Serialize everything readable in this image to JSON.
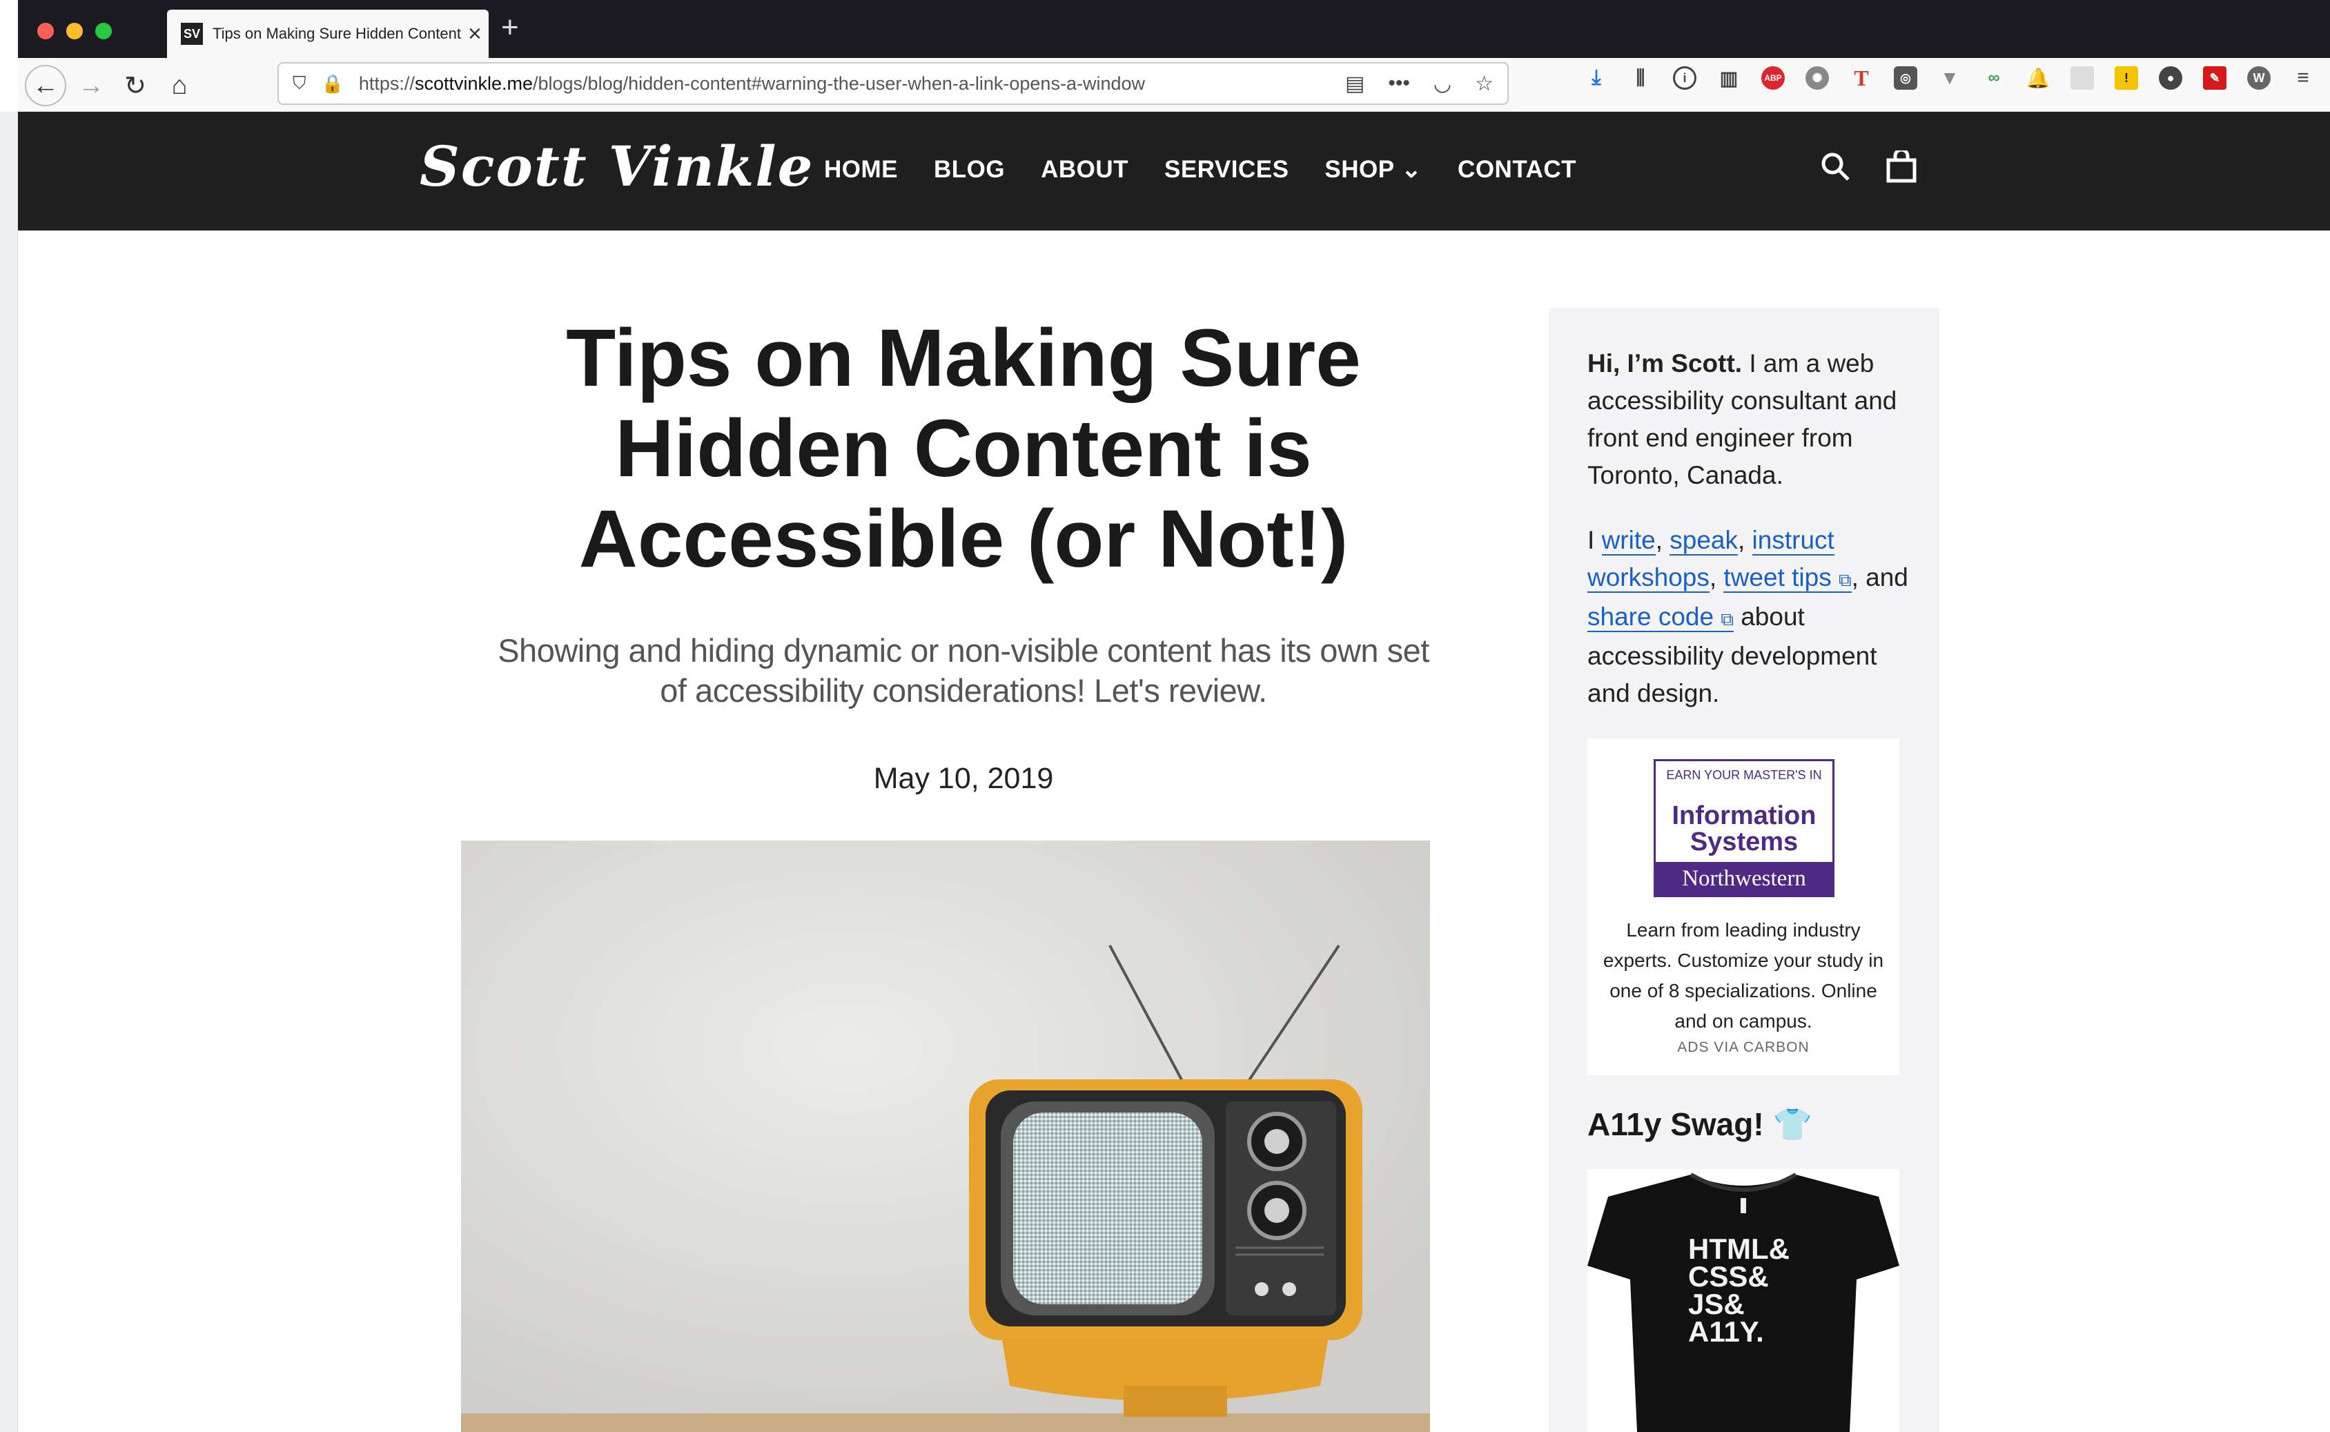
{
  "browser": {
    "tab_title": "Tips on Making Sure Hidden Content is Accessible (or Not!)",
    "tab_favicon": "SV",
    "new_tab": "+",
    "url_prefix": "https://",
    "url_domain": "scottvinkle.me",
    "url_path": "/blogs/blog/hidden-content#warning-the-user-when-a-link-opens-a-window",
    "extension_abp": "ABP",
    "extension_t": "T"
  },
  "site": {
    "logo": "Scott Vinkle",
    "nav": [
      "HOME",
      "BLOG",
      "ABOUT",
      "SERVICES",
      "SHOP",
      "CONTACT"
    ],
    "shop_caret": "⌄"
  },
  "article": {
    "title": "Tips on Making Sure Hidden Content is Accessible (or Not!)",
    "subtitle": "Showing and hiding dynamic or non-visible content has its own set of accessibility considerations! Let's review.",
    "date": "May 10, 2019"
  },
  "sidebar": {
    "intro_bold": "Hi, I’m Scott.",
    "intro_rest": " I am a web accessibility consultant and front end engineer from Toronto, Canada.",
    "i": "I ",
    "link_write": "write",
    "comma1": ", ",
    "link_speak": "speak",
    "comma2": ", ",
    "link_instruct": "instruct workshops",
    "comma3": ", ",
    "link_tweet": "tweet tips",
    "comma4": ", and ",
    "link_share": "share code",
    "tail": " about accessibility development and design.",
    "ad": {
      "line1": "EARN YOUR MASTER'S IN",
      "line2": "Information Systems",
      "line3": "Northwestern",
      "text": "Learn from leading industry experts. Customize your study in one of 8 specializations. Online and on campus.",
      "footer": "ADS VIA CARBON"
    },
    "swag_title": "A11y Swag!",
    "shirt_text": "HTML& CSS& JS& A11Y."
  }
}
